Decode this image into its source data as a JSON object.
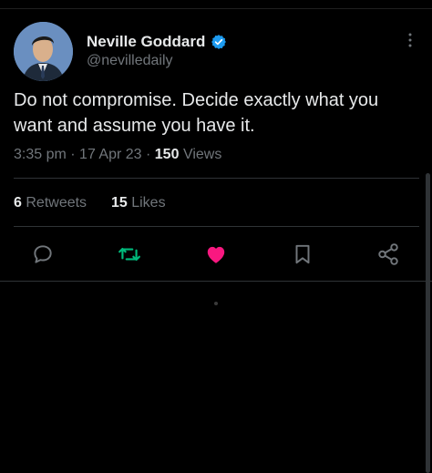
{
  "author": {
    "name": "Neville Goddard",
    "handle": "@nevilledaily",
    "verified_color": "#1d9bf0"
  },
  "tweet": {
    "text": "Do not compromise. Decide exactly what you want and assume you have it.",
    "time": "3:35 pm",
    "date": "17 Apr 23",
    "views_count": "150",
    "views_label": "Views"
  },
  "stats": {
    "retweets_count": "6",
    "retweets_label": "Retweets",
    "likes_count": "15",
    "likes_label": "Likes"
  },
  "actions": {
    "reply_icon": "reply-icon",
    "retweet_icon": "retweet-icon",
    "like_icon": "heart-icon",
    "bookmark_icon": "bookmark-icon",
    "share_icon": "share-icon",
    "retweet_color": "#00ba7c",
    "like_color": "#f91880"
  }
}
